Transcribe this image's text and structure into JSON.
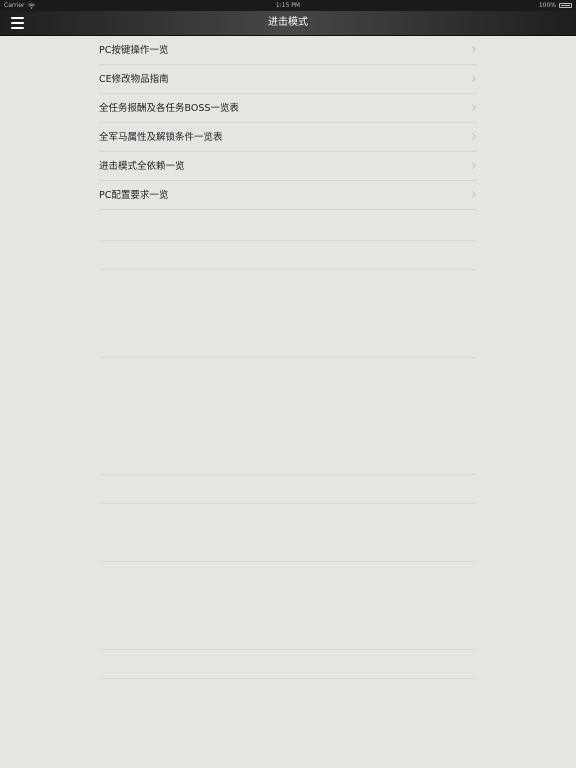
{
  "status_bar": {
    "carrier": "Carrier",
    "time": "1:15 PM",
    "battery": "100%"
  },
  "nav_bar": {
    "title": "进击模式"
  },
  "list": {
    "items": [
      {
        "label": "PC按键操作一览"
      },
      {
        "label": "CE修改物品指南"
      },
      {
        "label": "全任务报酬及各任务BOSS一览表"
      },
      {
        "label": "全军马属性及解锁条件一览表"
      },
      {
        "label": "进击模式全依赖一览"
      },
      {
        "label": "PC配置要求一览"
      }
    ]
  }
}
